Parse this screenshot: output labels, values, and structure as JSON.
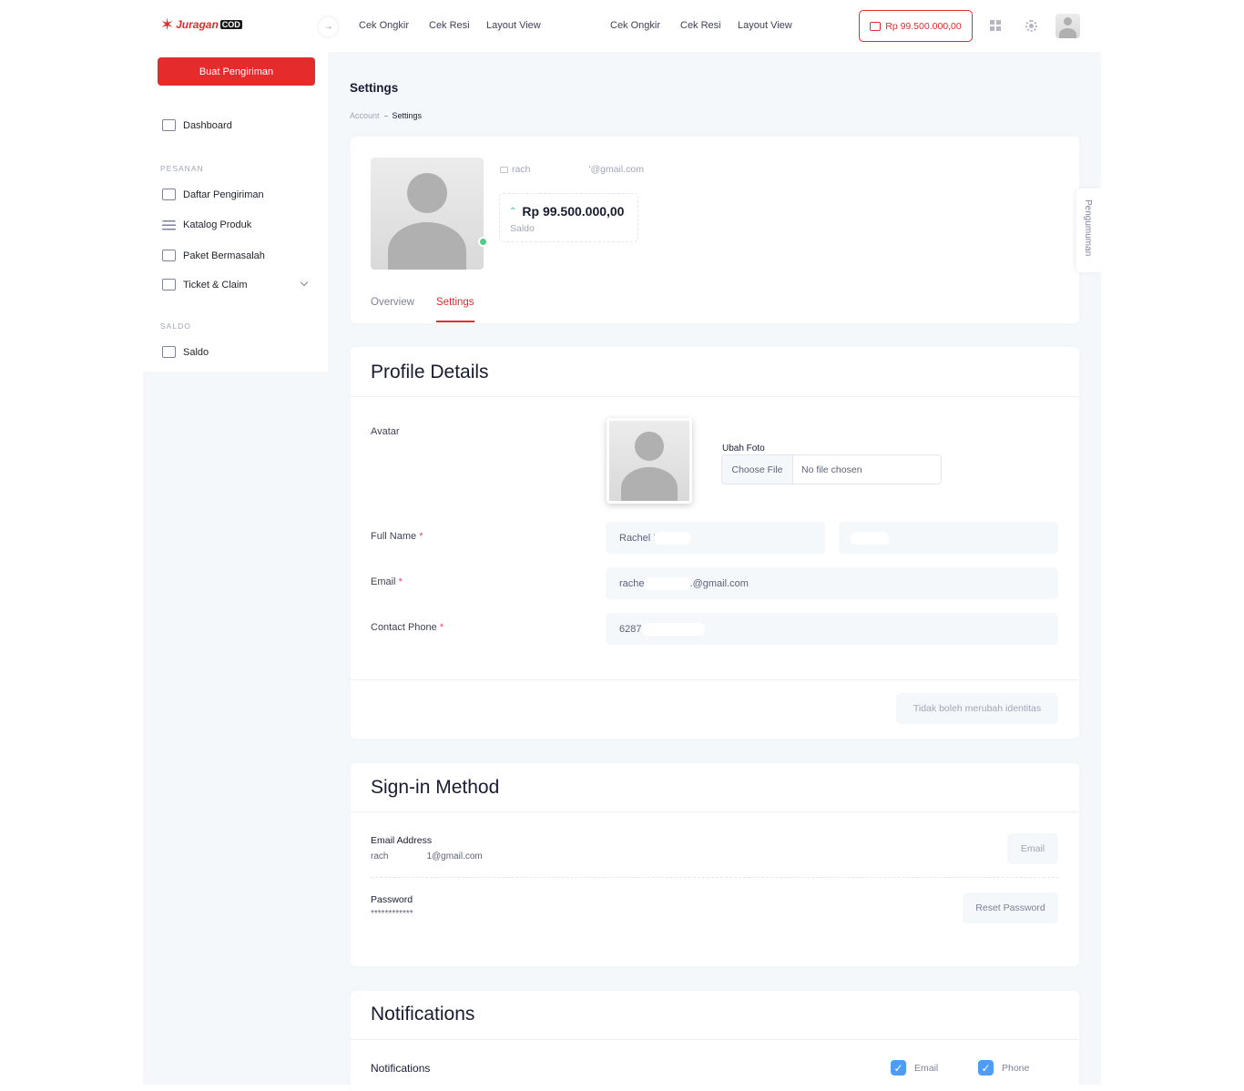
{
  "brand": {
    "name": "Juragan",
    "suffix": "COD"
  },
  "sidebar": {
    "cta": "Buat Pengiriman",
    "dashboard": "Dashboard",
    "section_pesanan": "PESANAN",
    "items": [
      "Daftar Pengiriman",
      "Katalog Produk",
      "Paket Bermasalah",
      "Ticket & Claim"
    ],
    "section_saldo": "SALDO",
    "saldo": "Saldo"
  },
  "header": {
    "nav": [
      "Cek Ongkir",
      "Cek Resi",
      "Layout View",
      "Cek Ongkir",
      "Cek Resi",
      "Layout View"
    ],
    "balance": "Rp 99.500.000,00"
  },
  "page": {
    "title": "Settings",
    "breadcrumb": [
      "Account",
      "Settings"
    ]
  },
  "profile": {
    "email_start": "rach",
    "email_end": "'@gmail.com",
    "saldo_value": "Rp 99.500.000,00",
    "saldo_label": "Saldo",
    "tabs": [
      "Overview",
      "Settings"
    ]
  },
  "profile_details": {
    "title": "Profile Details",
    "avatar_label": "Avatar",
    "ubah_foto": "Ubah Foto",
    "choose_file": "Choose File",
    "no_file": "No file chosen",
    "full_name_label": "Full Name",
    "first_name": "Rachel M",
    "email_label": "Email",
    "email_start": "rache",
    "email_end": ".@gmail.com",
    "phone_label": "Contact Phone",
    "phone": "6287",
    "submit_note": "Tidak boleh merubah identitas"
  },
  "signin": {
    "title": "Sign-in Method",
    "email_label": "Email Address",
    "email_start": "rach",
    "email_end": "1@gmail.com",
    "email_button": "Email",
    "password_label": "Password",
    "password_value": "************",
    "reset_button": "Reset Password"
  },
  "notifications": {
    "title": "Notifications",
    "row_label": "Notifications",
    "options": [
      "Email",
      "Phone"
    ]
  },
  "side_tab": "Pengumuman",
  "colors": {
    "accent": "#e52b2b",
    "online": "#50cd89",
    "check": "#4e9cf5"
  }
}
